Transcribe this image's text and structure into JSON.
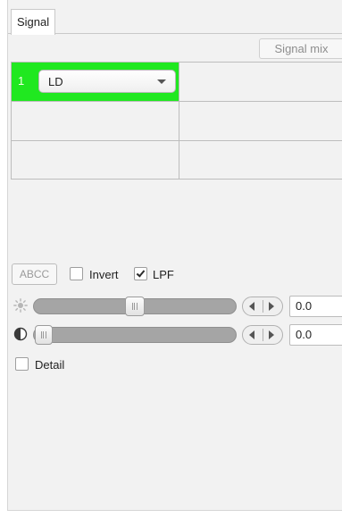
{
  "tabs": [
    {
      "label": "Signal",
      "selected": true
    }
  ],
  "toolbar": {
    "signal_mix_label": "Signal mix",
    "signal_mix_enabled": false
  },
  "signal_grid": {
    "active_color": "#20e820",
    "rows": [
      {
        "index": "1",
        "channel": "LD",
        "active": true
      },
      {
        "index": "",
        "channel": "",
        "active": false
      },
      {
        "index": "",
        "channel": "",
        "active": false
      }
    ]
  },
  "options": {
    "abcc_label": "ABCC",
    "abcc_enabled": false,
    "invert_label": "Invert",
    "invert_checked": false,
    "lpf_label": "LPF",
    "lpf_checked": true
  },
  "adjustments": {
    "brightness": {
      "icon": "brightness-icon",
      "value": "0.0",
      "level": 0.5
    },
    "contrast": {
      "icon": "contrast-icon",
      "value": "0.0",
      "level": 0.0
    }
  },
  "detail": {
    "label": "Detail",
    "checked": false
  }
}
